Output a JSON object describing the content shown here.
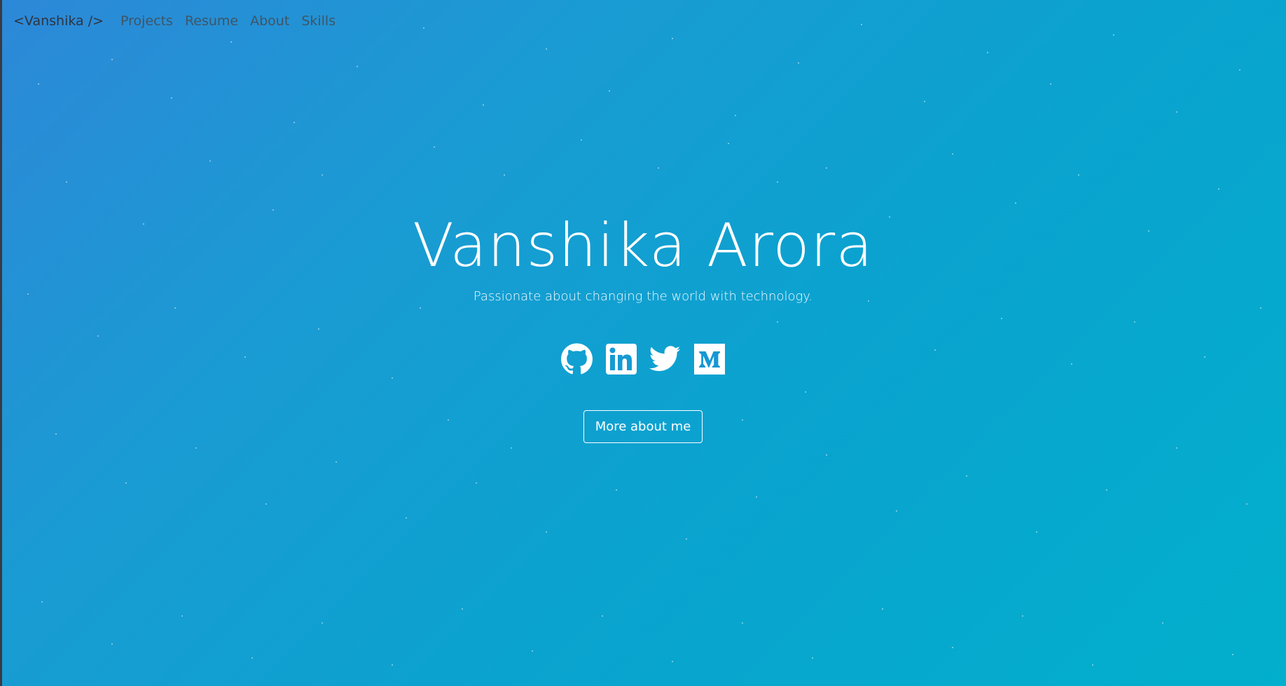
{
  "nav": {
    "brand": "<Vanshika />",
    "links": [
      "Projects",
      "Resume",
      "About",
      "Skills"
    ]
  },
  "hero": {
    "name": "Vanshika Arora",
    "tagline": "Passionate about changing the world with technology.",
    "cta_label": "More about me"
  },
  "socials": [
    {
      "name": "GitHub",
      "icon": "github-icon"
    },
    {
      "name": "LinkedIn",
      "icon": "linkedin-icon"
    },
    {
      "name": "Twitter",
      "icon": "twitter-icon"
    },
    {
      "name": "Medium",
      "icon": "medium-icon"
    }
  ],
  "colors": {
    "gradient_start": "#2d88d8",
    "gradient_end": "#02afcc",
    "text_light": "#ffffff",
    "nav_text": "#3f5566",
    "brand_text": "#2e3440"
  }
}
